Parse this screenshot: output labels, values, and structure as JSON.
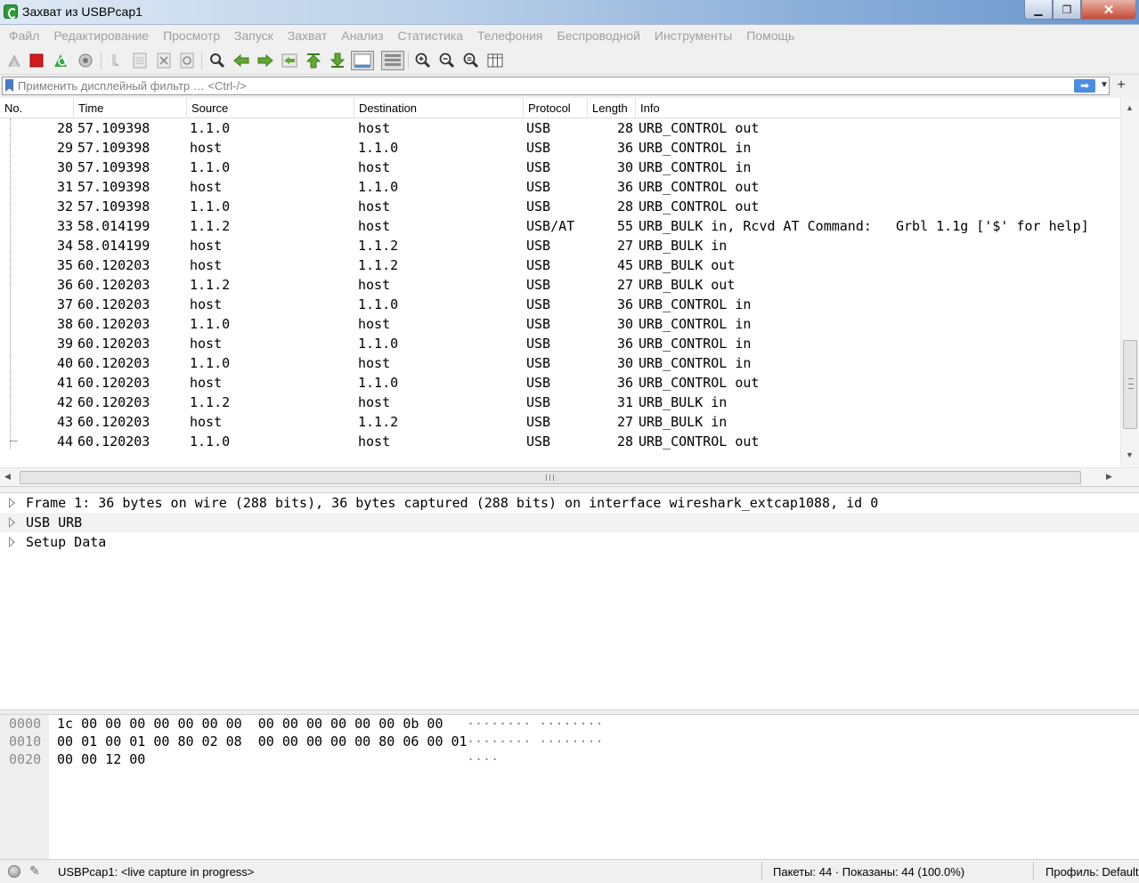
{
  "window": {
    "title": "Захват из USBPcap1"
  },
  "menu": [
    "Файл",
    "Редактирование",
    "Просмотр",
    "Запуск",
    "Захват",
    "Анализ",
    "Статистика",
    "Телефония",
    "Беспроводной",
    "Инструменты",
    "Помощь"
  ],
  "toolbar": {
    "icons": [
      "start-capture-icon",
      "stop-capture-icon",
      "restart-capture-icon",
      "capture-options-icon",
      "open-file-icon",
      "save-file-icon",
      "close-file-icon",
      "reload-file-icon",
      "find-packet-icon",
      "go-back-icon",
      "go-forward-icon",
      "go-to-packet-icon",
      "first-packet-icon",
      "last-packet-icon",
      "autoscroll-icon",
      "colorize-icon",
      "zoom-in-icon",
      "zoom-out-icon",
      "normal-size-icon",
      "resize-columns-icon"
    ]
  },
  "filter": {
    "placeholder": "Применить дисплейный фильтр … <Ctrl-/>",
    "apply_glyph": "➡",
    "add_glyph": "+"
  },
  "packet_list": {
    "columns": [
      "No.",
      "Time",
      "Source",
      "Destination",
      "Protocol",
      "Length",
      "Info"
    ],
    "rows": [
      {
        "no": "28",
        "time": "57.109398",
        "src": "1.1.0",
        "dst": "host",
        "proto": "USB",
        "len": "28",
        "info": "URB_CONTROL out"
      },
      {
        "no": "29",
        "time": "57.109398",
        "src": "host",
        "dst": "1.1.0",
        "proto": "USB",
        "len": "36",
        "info": "URB_CONTROL in"
      },
      {
        "no": "30",
        "time": "57.109398",
        "src": "1.1.0",
        "dst": "host",
        "proto": "USB",
        "len": "30",
        "info": "URB_CONTROL in"
      },
      {
        "no": "31",
        "time": "57.109398",
        "src": "host",
        "dst": "1.1.0",
        "proto": "USB",
        "len": "36",
        "info": "URB_CONTROL out"
      },
      {
        "no": "32",
        "time": "57.109398",
        "src": "1.1.0",
        "dst": "host",
        "proto": "USB",
        "len": "28",
        "info": "URB_CONTROL out"
      },
      {
        "no": "33",
        "time": "58.014199",
        "src": "1.1.2",
        "dst": "host",
        "proto": "USB/AT",
        "len": "55",
        "info": "URB_BULK in, Rcvd AT Command:   Grbl 1.1g ['$' for help]"
      },
      {
        "no": "34",
        "time": "58.014199",
        "src": "host",
        "dst": "1.1.2",
        "proto": "USB",
        "len": "27",
        "info": "URB_BULK in"
      },
      {
        "no": "35",
        "time": "60.120203",
        "src": "host",
        "dst": "1.1.2",
        "proto": "USB",
        "len": "45",
        "info": "URB_BULK out"
      },
      {
        "no": "36",
        "time": "60.120203",
        "src": "1.1.2",
        "dst": "host",
        "proto": "USB",
        "len": "27",
        "info": "URB_BULK out"
      },
      {
        "no": "37",
        "time": "60.120203",
        "src": "host",
        "dst": "1.1.0",
        "proto": "USB",
        "len": "36",
        "info": "URB_CONTROL in"
      },
      {
        "no": "38",
        "time": "60.120203",
        "src": "1.1.0",
        "dst": "host",
        "proto": "USB",
        "len": "30",
        "info": "URB_CONTROL in"
      },
      {
        "no": "39",
        "time": "60.120203",
        "src": "host",
        "dst": "1.1.0",
        "proto": "USB",
        "len": "36",
        "info": "URB_CONTROL in"
      },
      {
        "no": "40",
        "time": "60.120203",
        "src": "1.1.0",
        "dst": "host",
        "proto": "USB",
        "len": "30",
        "info": "URB_CONTROL in"
      },
      {
        "no": "41",
        "time": "60.120203",
        "src": "host",
        "dst": "1.1.0",
        "proto": "USB",
        "len": "36",
        "info": "URB_CONTROL out"
      },
      {
        "no": "42",
        "time": "60.120203",
        "src": "1.1.2",
        "dst": "host",
        "proto": "USB",
        "len": "31",
        "info": "URB_BULK in"
      },
      {
        "no": "43",
        "time": "60.120203",
        "src": "host",
        "dst": "1.1.2",
        "proto": "USB",
        "len": "27",
        "info": "URB_BULK in"
      },
      {
        "no": "44",
        "time": "60.120203",
        "src": "1.1.0",
        "dst": "host",
        "proto": "USB",
        "len": "28",
        "info": "URB_CONTROL out"
      }
    ]
  },
  "details": [
    "Frame 1: 36 bytes on wire (288 bits), 36 bytes captured (288 bits) on interface wireshark_extcap1088, id 0",
    "USB URB",
    "Setup Data"
  ],
  "bytes": [
    {
      "offset": "0000",
      "hex": "1c 00 00 00 00 00 00 00  00 00 00 00 00 00 0b 00",
      "ascii": "········ ········"
    },
    {
      "offset": "0010",
      "hex": "00 01 00 01 00 80 02 08  00 00 00 00 00 80 06 00 01",
      "ascii": "········ ········"
    },
    {
      "offset": "0020",
      "hex": "00 00 12 00",
      "ascii": "····"
    }
  ],
  "status": {
    "capture": "USBPcap1: <live capture in progress>",
    "packets": "Пакеты: 44 · Показаны: 44 (100.0%)",
    "profile": "Профиль: Default"
  },
  "colors": {
    "menu_disabled": "#a0a0a0",
    "stop_red": "#d81a1a",
    "accent_blue": "#4c8ce0"
  }
}
